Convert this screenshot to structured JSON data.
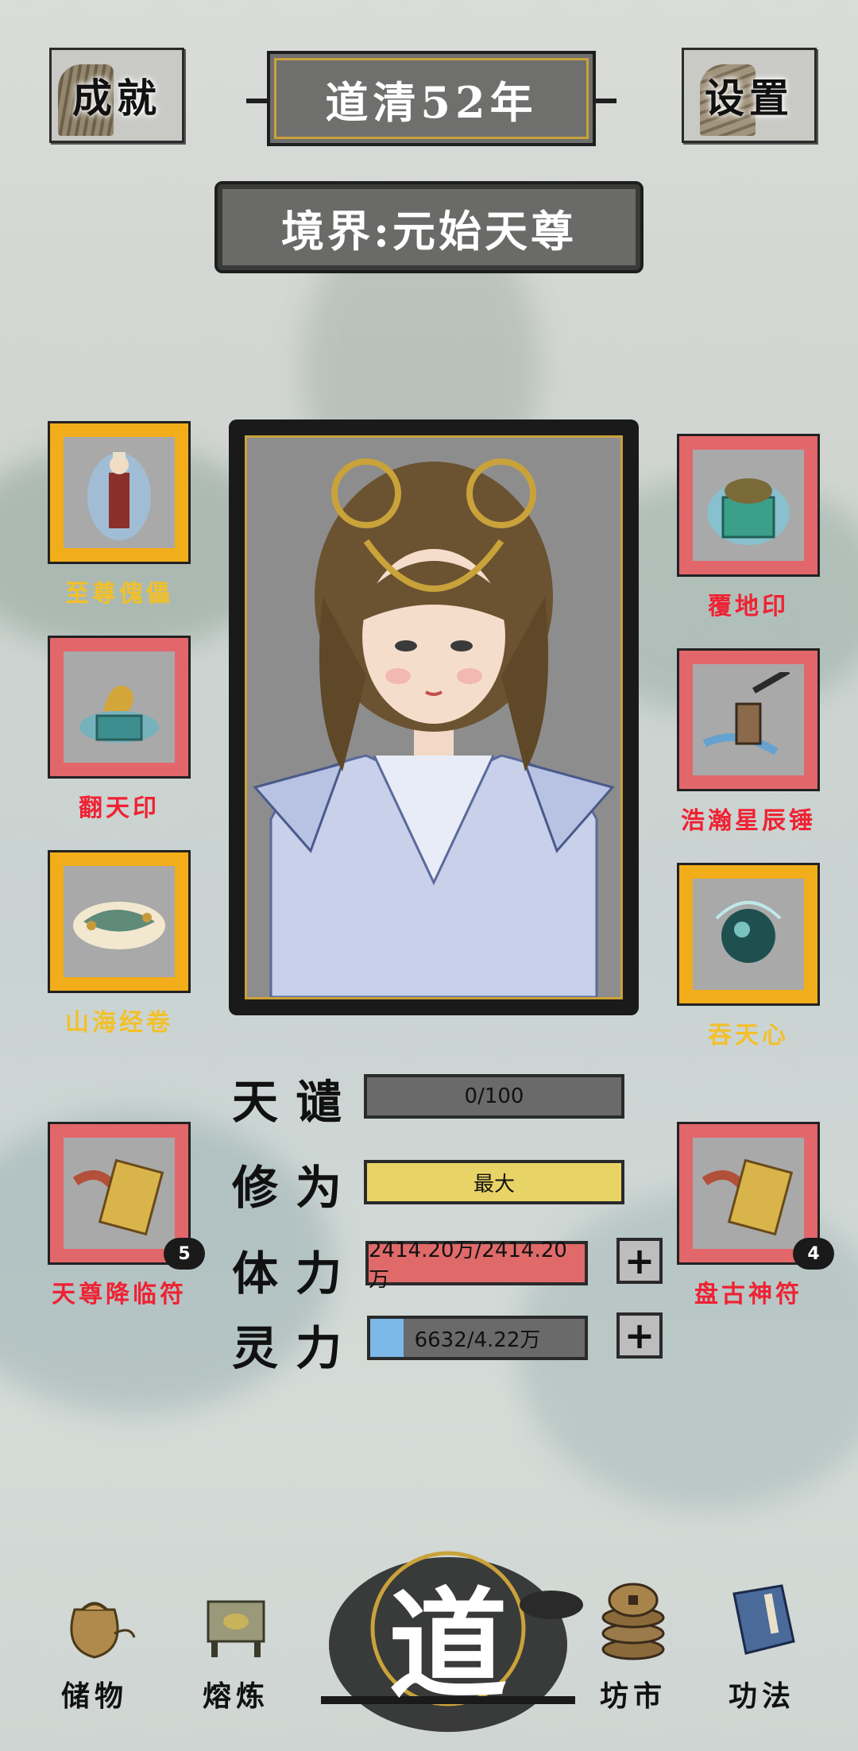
{
  "header": {
    "achievements_label": "成就",
    "year_label": "道清52年",
    "settings_label": "设置",
    "realm_label": "境界:元始天尊"
  },
  "equipment_left": [
    {
      "name": "至尊傀儡",
      "rarity": "gold",
      "icon": "puppet-icon"
    },
    {
      "name": "翻天印",
      "rarity": "red",
      "icon": "dragon-seal-icon"
    },
    {
      "name": "山海经卷",
      "rarity": "gold",
      "icon": "scroll-cloud-icon"
    }
  ],
  "equipment_right": [
    {
      "name": "覆地印",
      "rarity": "red",
      "icon": "turtle-seal-icon"
    },
    {
      "name": "浩瀚星辰锤",
      "rarity": "red",
      "icon": "hammer-icon"
    },
    {
      "name": "吞天心",
      "rarity": "gold",
      "icon": "orb-icon"
    }
  ],
  "talismans": {
    "left": {
      "name": "天尊降临符",
      "count": "5",
      "icon": "talisman-icon"
    },
    "right": {
      "name": "盘古神符",
      "count": "4",
      "icon": "talisman-icon"
    }
  },
  "stats": {
    "tribulation": {
      "label": "天谴",
      "value": "0/100",
      "fill": 0
    },
    "cultivation": {
      "label": "修为",
      "value": "最大",
      "fill": 1.0
    },
    "health": {
      "label": "体力",
      "value": "2414.20万/2414.20万",
      "fill": 1.0
    },
    "spirit": {
      "label": "灵力",
      "value": "6632/4.22万",
      "fill": 0.157
    }
  },
  "nav": {
    "storage": "储物",
    "refine": "熔炼",
    "dao": "道",
    "market": "坊市",
    "skills": "功法"
  },
  "colors": {
    "gold_rarity": "#f2ad1a",
    "red_rarity": "#e2676b",
    "cultivation_bar": "#e8d466",
    "health_bar": "#e06a6a",
    "spirit_bar": "#7cb8e8"
  }
}
